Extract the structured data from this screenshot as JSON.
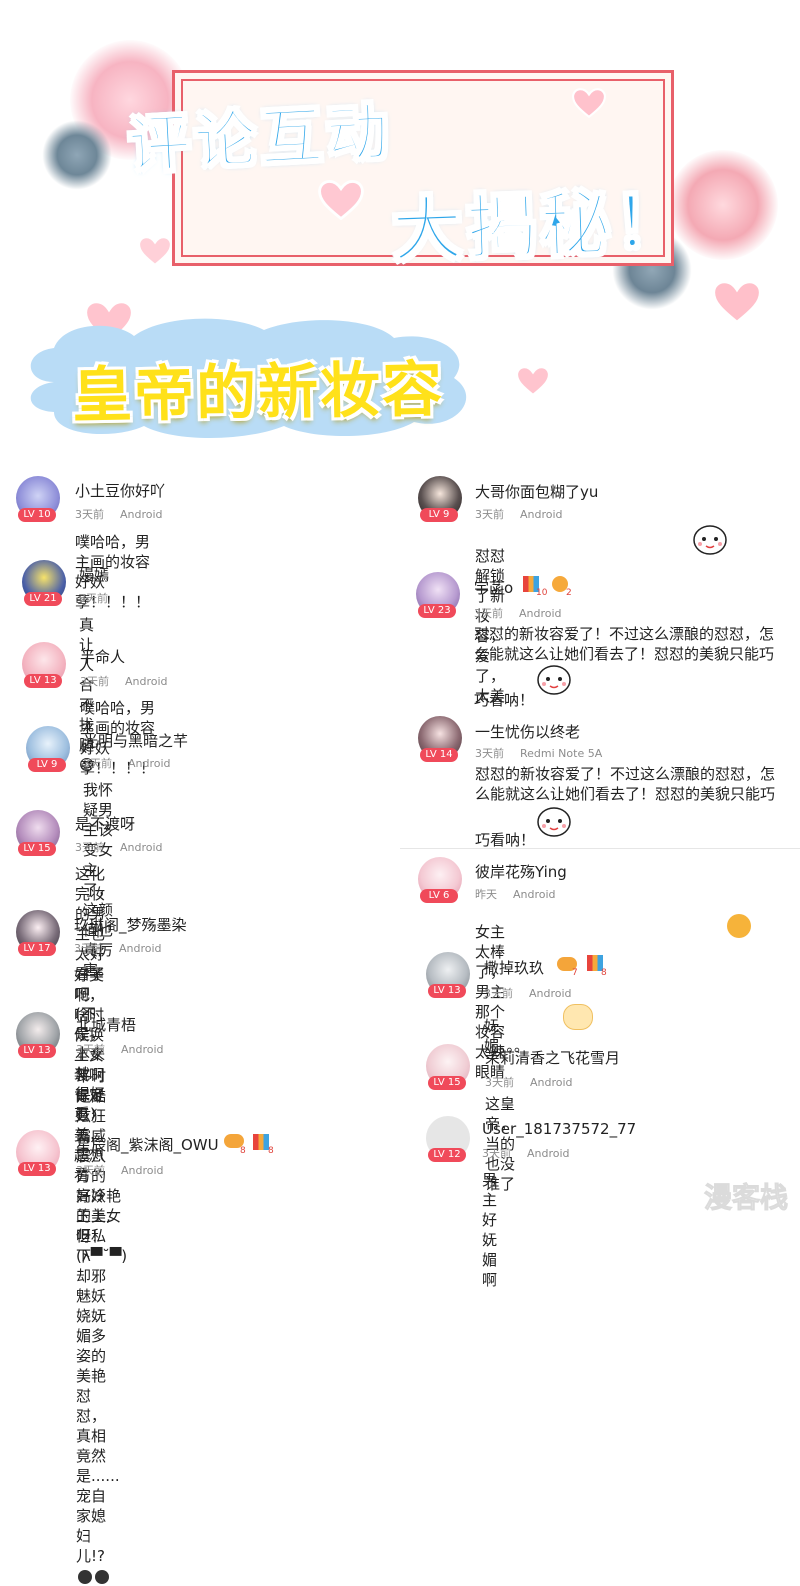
{
  "header": {
    "title_line1": "评论互动",
    "title_line2": "大揭秘！",
    "subtitle": "皇帝的新妆容"
  },
  "colors": {
    "title_blue": "#2ea6ea",
    "subtitle_yellow": "#ffe11a",
    "frame_red": "#e8606a",
    "level_red": "#f04a5a",
    "meta_gray": "#8c8c8c"
  },
  "comments_left": [
    {
      "name": "小土豆你好吖",
      "level": "LV 10",
      "time": "3天前",
      "device": "Android",
      "text": "噗哈哈，男主画的妆容好妖孽！！！！"
    },
    {
      "name": "嫚嫣",
      "level": "LV 21",
      "time": "3天前",
      "device": "",
      "text": "真让人合不拢腿😍"
    },
    {
      "name": "半命人",
      "level": "LV 13",
      "time": "3天前",
      "device": "Android",
      "text": "噗哈哈，男主画的妆容好妖孽！！！！"
    },
    {
      "name": "光明与黑暗之芊",
      "level": "LV 9",
      "time": "3天前",
      "device": "Android",
      "text": "我怀疑男主该变女主了，这颜值也真厉害。"
    },
    {
      "name": "是不渡呀",
      "level": "LV 15",
      "time": "3天前",
      "device": "Android",
      "text_lines": [
        "这化完妆的男主也太好看了吧(不是，本来就",
        "很好看)"
      ]
    },
    {
      "name": "玖琳阁_梦殇墨染",
      "level": "LV 17",
      "time": "3天前",
      "device": "Android",
      "text_lines": [
        "好美啊，啥时候换上女装啊",
        "肯定更美，超想看"
      ]
    },
    {
      "name": "北城青梧",
      "level": "LV 13",
      "time": "3天前",
      "device": "Android",
      "text_lines": [
        "平时是酷炫狂霸威震八方的高冷王上,但私下",
        "却邪魅妖娆妩媚多姿的美艳怼怼，真相竟然",
        "是......宠自家媳妇儿!?"
      ]
    },
    {
      "name": "星辰阁_紫沫阁_OWU",
      "level": "LV 13",
      "time": "3天前",
      "device": "Android",
      "text": "好妖艳的美女呀！(λ▀˘▀)",
      "badges": [
        "8",
        "8"
      ]
    }
  ],
  "comments_right": [
    {
      "name": "大哥你面包糊了yu",
      "level": "LV 9",
      "time": "3天前",
      "device": "Android",
      "text": "怼怼解锁了新妆容，爱了，太美"
    },
    {
      "name": "宇菡o",
      "level": "LV 23",
      "time": "3天前",
      "device": "Android",
      "text_lines": [
        "怼怼的新妆容爱了！不过这么漂酿的怼怼，怎",
        "么能就这么让她们看去了！怼怼的美貌只能巧",
        "巧看呐！"
      ],
      "badges": [
        "10",
        "2"
      ]
    },
    {
      "name": "一生忧伤以终老",
      "level": "LV 14",
      "time": "3天前",
      "device": "Redmi Note 5A",
      "text_lines": [
        "怼怼的新妆容爱了！不过这么漂酿的怼怼，怎",
        "么能就这么让她们看去了！怼怼的美貌只能巧",
        "巧看呐！"
      ]
    },
    {
      "name": "彼岸花殇Ying",
      "level": "LV 6",
      "time": "昨天",
      "device": "Android",
      "text": "女主太棒了，男主那个妆容太辣眼睛"
    },
    {
      "name": "撒掉玖玖",
      "level": "LV 13",
      "time": "3天前",
      "device": "Android",
      "text": "妩媚。。。",
      "badges": [
        "7",
        "8"
      ]
    },
    {
      "name": "茉莉清香之飞花雪月",
      "level": "LV 15",
      "time": "3天前",
      "device": "Android",
      "text": "这皇帝，当的也没谁了"
    },
    {
      "name": "User_181737572_77",
      "level": "LV 12",
      "time": "3天前",
      "device": "Android",
      "text": "男主好妩媚啊"
    }
  ],
  "watermark": "漫客栈"
}
